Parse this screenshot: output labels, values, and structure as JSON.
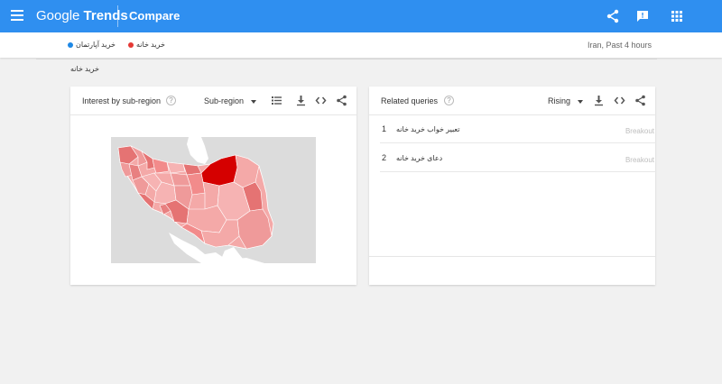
{
  "header": {
    "logo_google": "Google",
    "logo_trends": "Trends",
    "title": "Compare",
    "color": "#2f8ff0"
  },
  "compare": {
    "terms": [
      {
        "label": "خرید خانه",
        "color": "#e53935"
      },
      {
        "label": "خرید آپارتمان",
        "color": "#1e88e5"
      }
    ],
    "meta": "Iran, Past 4 hours"
  },
  "section_label": "خرید خانه",
  "interest": {
    "title": "Interest by sub-region",
    "help": "?",
    "select_value": "Sub-region",
    "icons": [
      "list-view-icon",
      "download-icon",
      "embed-icon",
      "share-icon"
    ],
    "map_colors": {
      "low": "#f4a9a8",
      "mid": "#e57373",
      "high": "#d50000"
    }
  },
  "related": {
    "title": "Related queries",
    "help": "?",
    "select_value": "Rising",
    "queries": [
      {
        "rank": "1",
        "text": "تعبیر خواب خرید خانه",
        "value": "Breakout"
      },
      {
        "rank": "2",
        "text": "دعای خرید خانه",
        "value": "Breakout"
      }
    ]
  }
}
